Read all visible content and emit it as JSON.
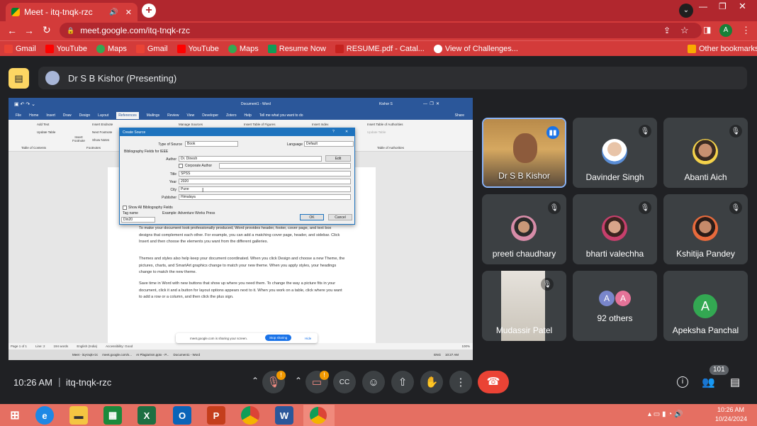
{
  "browser": {
    "tab_title": "Meet - itq-tnqk-rzc",
    "url": "meet.google.com/itq-tnqk-rzc",
    "bookmarks": [
      "Gmail",
      "YouTube",
      "Maps",
      "Gmail",
      "YouTube",
      "Maps",
      "Resume Now",
      "RESUME.pdf - Catal...",
      "View of Challenges..."
    ],
    "other_bookmarks": "Other bookmarks",
    "profile_letter": "A"
  },
  "meet": {
    "presenter_label": "Dr S B Kishor (Presenting)",
    "meeting_time": "10:26 AM",
    "meeting_code": "itq-tnqk-rzc",
    "participant_count": "101",
    "others_count_label": "92 others",
    "participants": [
      {
        "name": "Dr S B Kishor"
      },
      {
        "name": "Davinder Singh"
      },
      {
        "name": "Abanti Aich"
      },
      {
        "name": "preeti chaudhary"
      },
      {
        "name": "bharti valechha"
      },
      {
        "name": "Kshitija Pandey"
      },
      {
        "name": "Mudassir Patel"
      },
      {
        "name": "Apeksha Panchal",
        "initial": "A"
      }
    ],
    "others_initials": [
      "A",
      "A"
    ],
    "alert_badge": "!"
  },
  "word": {
    "title": "Document1 - Word",
    "user": "Kishor S",
    "tabs": [
      "File",
      "Home",
      "Insert",
      "Draw",
      "Design",
      "Layout",
      "References",
      "Mailings",
      "Review",
      "View",
      "Developer",
      "Zotero",
      "Help"
    ],
    "tell_me": "Tell me what you want to do",
    "share": "Share",
    "ribbon_groups": [
      "Table of Contents",
      "Footnotes",
      "Table of Authorities"
    ],
    "ribbon_items": [
      "Add Text",
      "Update Table",
      "Insert Endnote",
      "Next Footnote",
      "Show Notes",
      "Insert Footnote",
      "Manage Sources",
      "Insert Table of Figures",
      "Insert Index",
      "Insert Table of Authorities",
      "Update Table"
    ],
    "paragraphs": [
      "To make your document look professionally produced, Word provides header, footer, cover page, and text box designs that complement each other. For example, you can add a matching cover page, header, and sidebar. Click Insert and then choose the elements you want from the different galleries.",
      "Themes and styles also help keep your document coordinated. When you click Design and choose a new Theme, the pictures, charts, and SmartArt graphics change to match your new theme. When you apply styles, your headings change to match the new theme.",
      "Save time in Word with new buttons that show up where you need them. To change the way a picture fits in your document, click it and a button for layout options appears next to it. When you work on a table, click where you want to add a row or a column, and then click the plus sign."
    ],
    "status": {
      "page": "Page 1 of 1",
      "line": "Line: 2",
      "words": "194 words",
      "lang": "English (India)",
      "accessibility": "Accessibility: Good",
      "zoom": "100%"
    },
    "sharing_bar": {
      "text": "meet.google.com is sharing your screen.",
      "stop": "Stop sharing",
      "hide": "Hide"
    },
    "inner_taskbar": [
      "Meet - itq-tnqk-rzc",
      "meet.google.com/s...",
      "AI Plagiarism.pptx - P...",
      "Document1 - Word"
    ],
    "inner_clock": "10:27 AM",
    "inner_lang": "ENG"
  },
  "dialog": {
    "title": "Create Source",
    "type_label": "Type of Source",
    "type_value": "Book",
    "language_label": "Language",
    "language_value": "Default",
    "section": "Bibliography Fields for IEEE",
    "author_label": "Author",
    "author_value": "Dr. Dinesh",
    "edit": "Edit",
    "corporate_label": "Corporate Author",
    "title_label": "Title",
    "title_value": "SPSS",
    "year_label": "Year",
    "year_value": "2020",
    "city_label": "City",
    "city_value": "Pune",
    "publisher_label": "Publisher",
    "publisher_value": "Himalaya",
    "show_all": "Show All Bibliography Fields",
    "tag_label": "Tag name",
    "tag_value": "Din20",
    "example": "Example: Adventure Works Press",
    "ok": "OK",
    "cancel": "Cancel"
  },
  "taskbar": {
    "time": "10:26 AM",
    "date": "10/24/2024"
  },
  "colors": {
    "chrome": "#d33b3a",
    "meet_bg": "#202124",
    "tile": "#3c4043",
    "end_call": "#ea4335",
    "stop_sharing": "#1a73e8",
    "word_blue": "#2b579a"
  }
}
